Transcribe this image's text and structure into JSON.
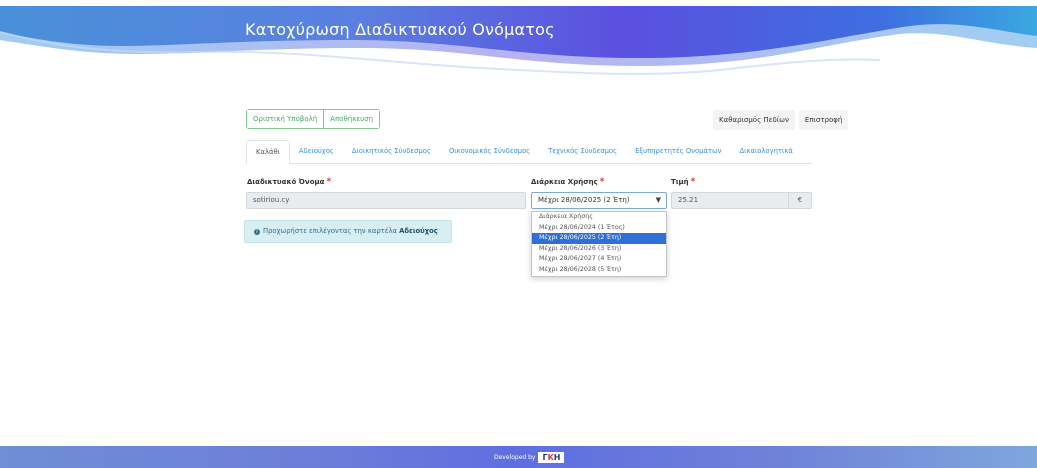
{
  "header": {
    "title": "Κατοχύρωση Διαδικτυακού Ονόματος"
  },
  "toolbar": {
    "left_buttons": [
      "Οριστική Υποβολή",
      "Αποθήκευση"
    ],
    "right_buttons": [
      "Καθαρισμός Πεδίων",
      "Επιστροφή"
    ]
  },
  "tabs": [
    "Καλάθι",
    "Αδειούχος",
    "Διοικητικός Σύνδεσμος",
    "Οικονομικός Σύνδεσμος",
    "Τεχνικός Σύνδεσμος",
    "Εξυπηρετητές Ονομάτων",
    "Δικαιολογητικά"
  ],
  "active_tab": "Καλάθι",
  "form": {
    "domain_label": "Διαδικτυακό Όνομα",
    "domain_value": "sotiriou.cy",
    "duration_label": "Διάρκεια Χρήσης",
    "duration_value": "Μέχρι 28/06/2025 (2 Έτη)",
    "price_label": "Τιμή",
    "price_value": "25.21",
    "currency": "€",
    "required_marker": "*"
  },
  "dropdown": {
    "options": [
      "Διάρκεια Χρήσης",
      "Μέχρι 28/06/2024 (1 Έτος)",
      "Μέχρι 28/06/2025 (2 Έτη)",
      "Μέχρι 28/06/2026 (3 Έτη)",
      "Μέχρι 28/06/2027 (4 Έτη)",
      "Μέχρι 28/06/2028 (5 Έτη)"
    ],
    "selected": "Μέχρι 28/06/2025 (2 Έτη)"
  },
  "alert": {
    "prefix": "Προχωρήστε επιλέγοντας την καρτέλα ",
    "emphasis": "Αδειούχος"
  },
  "footer": {
    "developed_by": "Developed by",
    "logo_left": "Γ",
    "logo_mid": "Κ",
    "logo_right": "Η"
  },
  "icons": {
    "info": "info-circle-icon",
    "caret": "chevron-down-icon"
  },
  "colors": {
    "accent": "#3a8fd6",
    "success": "#4aa564",
    "danger": "#e0343a",
    "selected": "#2f6fd6"
  }
}
